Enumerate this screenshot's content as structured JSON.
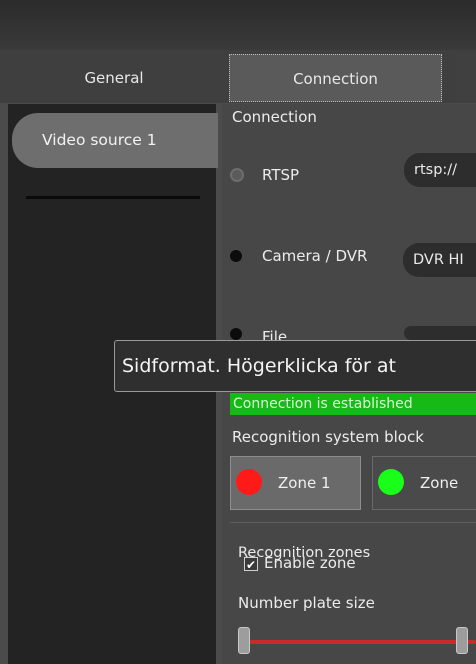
{
  "tabs": [
    {
      "label": "General"
    },
    {
      "label": "Connection"
    }
  ],
  "sidebar": {
    "items": [
      {
        "label": "Video source 1"
      }
    ]
  },
  "connection": {
    "section_title": "Connection",
    "rtsp": {
      "label": "RTSP",
      "value": "rtsp://"
    },
    "camera": {
      "label": "Camera / DVR",
      "value": "DVR HI"
    },
    "file": {
      "label": "File"
    }
  },
  "tooltip": {
    "text": "Sidformat. Högerklicka för at"
  },
  "status": {
    "text": "Connection is established",
    "color": "#16b916"
  },
  "recognition": {
    "block_title": "Recognition system block",
    "zones": [
      {
        "label": "Zone 1",
        "color": "#ff1a1a"
      },
      {
        "label": "Zone",
        "color": "#1aff1a"
      }
    ],
    "zones_group_title": "Recognition zones",
    "enable_zone_label": "Enable zone",
    "enable_zone_checked": true,
    "plate_size_label": "Number plate size"
  },
  "icons": {
    "checkmark": "✔"
  }
}
